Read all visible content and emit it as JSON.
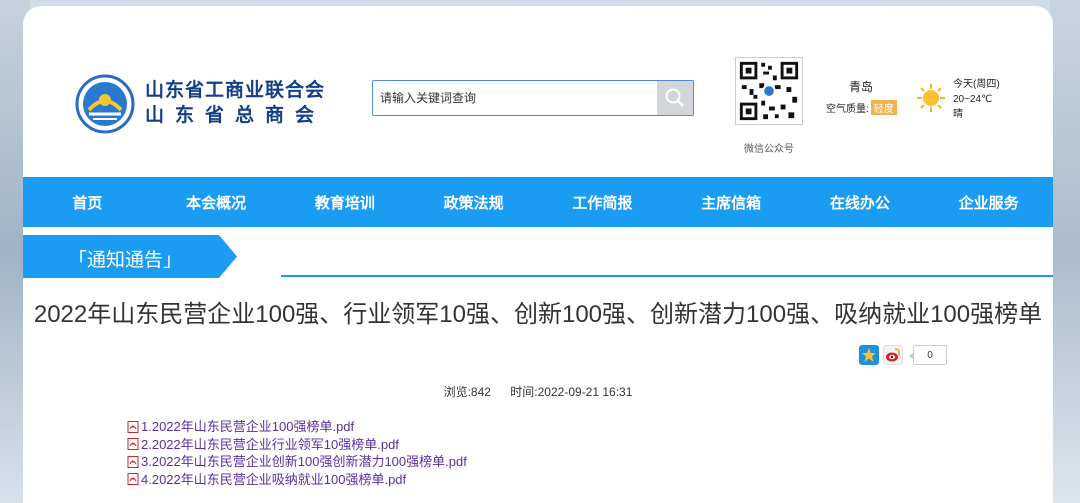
{
  "header": {
    "org_line1": "山东省工商业联合会",
    "org_line2": "山东省总商会",
    "search_placeholder": "请输入关键词查询",
    "qr_caption": "微信公众号",
    "weather": {
      "city": "青岛",
      "air_quality_label": "空气质量:",
      "air_quality_value": "轻度",
      "day": "今天(周四)",
      "temp": "20~24℃",
      "condition": "晴",
      "icon": "sun-icon"
    }
  },
  "nav": {
    "items": [
      {
        "label": "首页"
      },
      {
        "label": "本会概况"
      },
      {
        "label": "教育培训"
      },
      {
        "label": "政策法规"
      },
      {
        "label": "工作简报"
      },
      {
        "label": "主席信箱"
      },
      {
        "label": "在线办公"
      },
      {
        "label": "企业服务"
      }
    ]
  },
  "section": {
    "label": "「通知通告」"
  },
  "article": {
    "title": "2022年山东民营企业100强、行业领军10强、创新100强、创新潜力100强、吸纳就业100强榜单",
    "share_count": "0",
    "views": "浏览:842",
    "time": "时间:2022-09-21 16:31",
    "attachments": [
      {
        "label": "1.2022年山东民营企业100强榜单.pdf"
      },
      {
        "label": "2.2022年山东民营企业行业领军10强榜单.pdf"
      },
      {
        "label": "3.2022年山东民营企业创新100强创新潜力100强榜单.pdf"
      },
      {
        "label": "4.2022年山东民营企业吸纳就业100强榜单.pdf"
      }
    ]
  },
  "colors": {
    "nav_bg": "#1a9cf2",
    "logo_text": "#123f86",
    "link": "#5a2fa0"
  }
}
